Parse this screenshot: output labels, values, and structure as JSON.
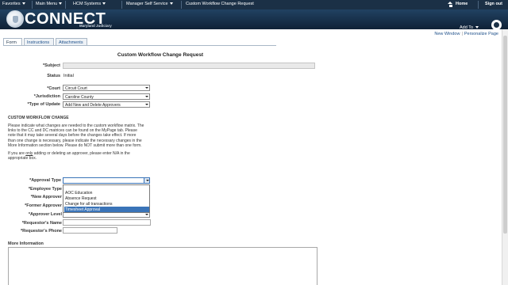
{
  "topnav": {
    "favorites": "Favorites",
    "main_menu": "Main Menu",
    "hcm_systems": "HCM Systems",
    "manager_self_service": "Manager Self Service",
    "breadcrumb_current": "Custom Workflow Change Request",
    "home": "Home",
    "sign_out": "Sign out"
  },
  "banner": {
    "logo": "CONNECT",
    "subtitle": "Maryland Judiciary",
    "add_to": "Add To",
    "navbar": "NavBar"
  },
  "sublinks": {
    "new_window": "New Window",
    "personalize_page": "Personalize Page"
  },
  "tabs": [
    "Form",
    "Instructions",
    "Attachments"
  ],
  "form": {
    "title": "Custom Workflow Change Request",
    "subject_label": "*Subject",
    "subject_value": "",
    "status_label": "Status",
    "status_value": "Initial",
    "court_label": "*Court",
    "court_value": "Circuit Court",
    "jurisdiction_label": "*Jurisdiction",
    "jurisdiction_value": "Caroline County",
    "type_label": "*Type of Update",
    "type_value": "Add New and Delete Approvers",
    "section_heading": "CUSTOM WORKFLOW CHANGE",
    "para1_lines": [
      "Please indicate what changes are needed to the custom workflow matrix. The",
      "links to the CC and DC matrices can be found on the MyPage tab.  Please",
      "note that it may take several days before the changes take effect.  If more",
      "than one change is necessary, please indicate the necessary changes in the",
      "More Information section below.  Please do NOT submit more than one form."
    ],
    "para2_prefix": "If you are ",
    "para2_only": "only",
    "para2_suffix": " adding or deleting an approver, please enter N/A in the",
    "para2_line2": "appropriate box.",
    "approval_type_label": "*Approval Type",
    "approval_type_value": "",
    "employee_type_label": "*Employee Type",
    "new_approver_label": "*New Approver",
    "former_approver_label": "*Former Approver",
    "approver_level_label": "*Approver Level",
    "requestor_name_label": "*Requestor's Name",
    "requestor_phone_label": "*Requestor's Phone",
    "more_info_label": "More Information"
  },
  "approval_options": [
    "",
    "AOC Education",
    "Absence Request",
    "Change for all transactions",
    "Timesheet Approval"
  ],
  "approval_selected_index": 4,
  "colors": {
    "topnav_bg": "#1b3046",
    "banner_bg": "#214262",
    "link": "#1d4f8a",
    "selected_option": "#3a74b8"
  }
}
